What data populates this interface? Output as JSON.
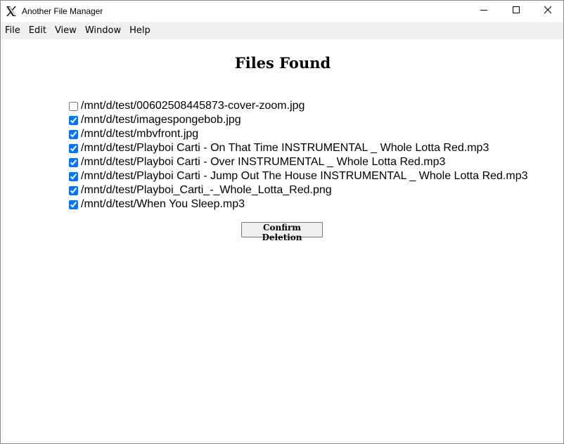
{
  "window": {
    "title": "Another File Manager",
    "app_icon": "x-logo-icon",
    "controls": {
      "minimize_icon": "minimize-icon",
      "maximize_icon": "maximize-icon",
      "close_icon": "close-icon"
    }
  },
  "menubar": {
    "items": [
      {
        "label": "File"
      },
      {
        "label": "Edit"
      },
      {
        "label": "View"
      },
      {
        "label": "Window"
      },
      {
        "label": "Help"
      }
    ]
  },
  "main": {
    "heading": "Files Found",
    "files": [
      {
        "path": "/mnt/d/test/00602508445873-cover-zoom.jpg",
        "checked": false
      },
      {
        "path": "/mnt/d/test/imagespongebob.jpg",
        "checked": true
      },
      {
        "path": "/mnt/d/test/mbvfront.jpg",
        "checked": true
      },
      {
        "path": "/mnt/d/test/Playboi Carti - On That Time INSTRUMENTAL _ Whole Lotta Red.mp3",
        "checked": true
      },
      {
        "path": "/mnt/d/test/Playboi Carti - Over INSTRUMENTAL _ Whole Lotta Red.mp3",
        "checked": true
      },
      {
        "path": "/mnt/d/test/Playboi Carti - Jump Out The House INSTRUMENTAL _ Whole Lotta Red.mp3",
        "checked": true
      },
      {
        "path": "/mnt/d/test/Playboi_Carti_-_Whole_Lotta_Red.png",
        "checked": true
      },
      {
        "path": "/mnt/d/test/When You Sleep.mp3",
        "checked": true
      }
    ],
    "confirm_label": "Confirm Deletion"
  },
  "colors": {
    "menubar_bg": "#f0f0f0",
    "checkbox_accent": "#0075ff",
    "button_bg": "#efefef"
  }
}
